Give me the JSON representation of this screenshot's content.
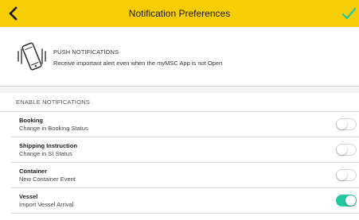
{
  "header": {
    "title": "Notification Preferences",
    "color": "#f7cd06"
  },
  "push": {
    "icon": "phone-vibrate-icon",
    "title": "PUSH NOTIFICATIONS",
    "subtitle": "Receive important alert even when the myMSC App is not Open"
  },
  "section": {
    "label": "ENABLE NOTIFICATIONS"
  },
  "items": [
    {
      "title": "Booking",
      "subtitle": "Change in Booking Status",
      "enabled": false
    },
    {
      "title": "Shipping Instruction",
      "subtitle": "Change in SI Status",
      "enabled": false
    },
    {
      "title": "Container",
      "subtitle": "New Container Event",
      "enabled": false
    },
    {
      "title": "Vessel",
      "subtitle": "Import Vessel Arrival",
      "enabled": true
    }
  ],
  "colors": {
    "toggle_on": "#25c9a1",
    "confirm_check": "#25c9a1"
  }
}
